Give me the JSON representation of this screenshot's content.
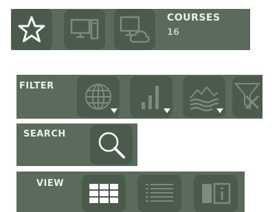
{
  "top_bar": {
    "courses_label": "COURSES",
    "courses_count": "16",
    "buttons": [
      {
        "icon": "star-icon"
      },
      {
        "icon": "desktop-computer-icon"
      },
      {
        "icon": "cloud-computer-icon"
      }
    ]
  },
  "filter": {
    "label": "FILTER",
    "buttons": [
      {
        "icon": "globe-icon",
        "has_dropdown": true
      },
      {
        "icon": "bar-chart-icon",
        "has_dropdown": true
      },
      {
        "icon": "landscape-icon",
        "has_dropdown": true
      },
      {
        "icon": "clear-filter-icon",
        "has_dropdown": false
      }
    ]
  },
  "search": {
    "label": "SEARCH",
    "button": {
      "icon": "search-icon"
    }
  },
  "view": {
    "label": "VIEW",
    "buttons": [
      {
        "icon": "grid-view-icon",
        "active": true
      },
      {
        "icon": "list-view-icon",
        "active": false
      },
      {
        "icon": "detail-view-icon",
        "active": false
      }
    ]
  },
  "colors": {
    "panel": "#5a6b5b",
    "button": "#4a5a4c",
    "text": "#e9efe9",
    "icon_active": "#ffffff",
    "icon_inactive": "#7d8c7e"
  }
}
